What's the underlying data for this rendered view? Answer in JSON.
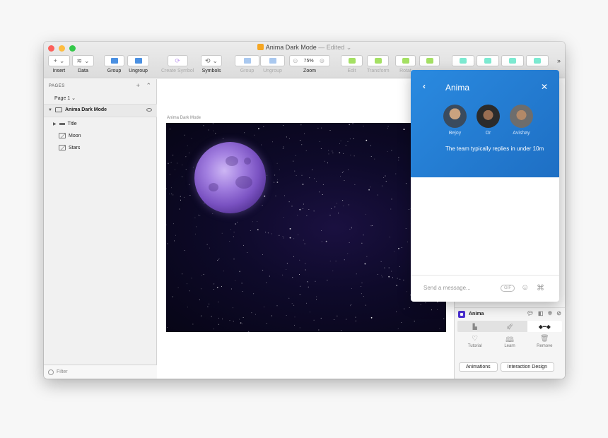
{
  "window": {
    "title": "Anima Dark Mode",
    "edited": "— Edited ⌄"
  },
  "toolbar": {
    "insert": "Insert",
    "data": "Data",
    "group": "Group",
    "ungroup": "Ungroup",
    "create_symbol": "Create Symbol",
    "symbols": "Symbols",
    "group2": "Group",
    "ungroup2": "Ungroup",
    "zoom": "Zoom",
    "zoom_value": "75%",
    "edit": "Edit",
    "transform": "Transform",
    "rotate": "Rotat",
    "overflow": "»"
  },
  "sidebar": {
    "pages_header": "PAGES",
    "page_selected": "Page 1 ⌄",
    "artboard": "Anima Dark Mode",
    "layers": [
      "Title",
      "Moon",
      "Stars"
    ],
    "filter": "Filter"
  },
  "canvas": {
    "artboard_label": "Anima Dark Mode"
  },
  "chat": {
    "title": "Anima",
    "team": [
      "Bejoy",
      "Or",
      "Avishay"
    ],
    "reply_text": "The team typically replies in under 10m",
    "placeholder": "Send a message...",
    "gif": "GIF"
  },
  "anima_panel": {
    "title": "Anima",
    "actions": [
      "Tutorial",
      "Learn",
      "Remove"
    ],
    "buttons": [
      "Animations",
      "Interaction Design"
    ]
  },
  "colors": {
    "chat_accent": "#2a8ae0",
    "anima_brand": "#4a2fd0"
  }
}
